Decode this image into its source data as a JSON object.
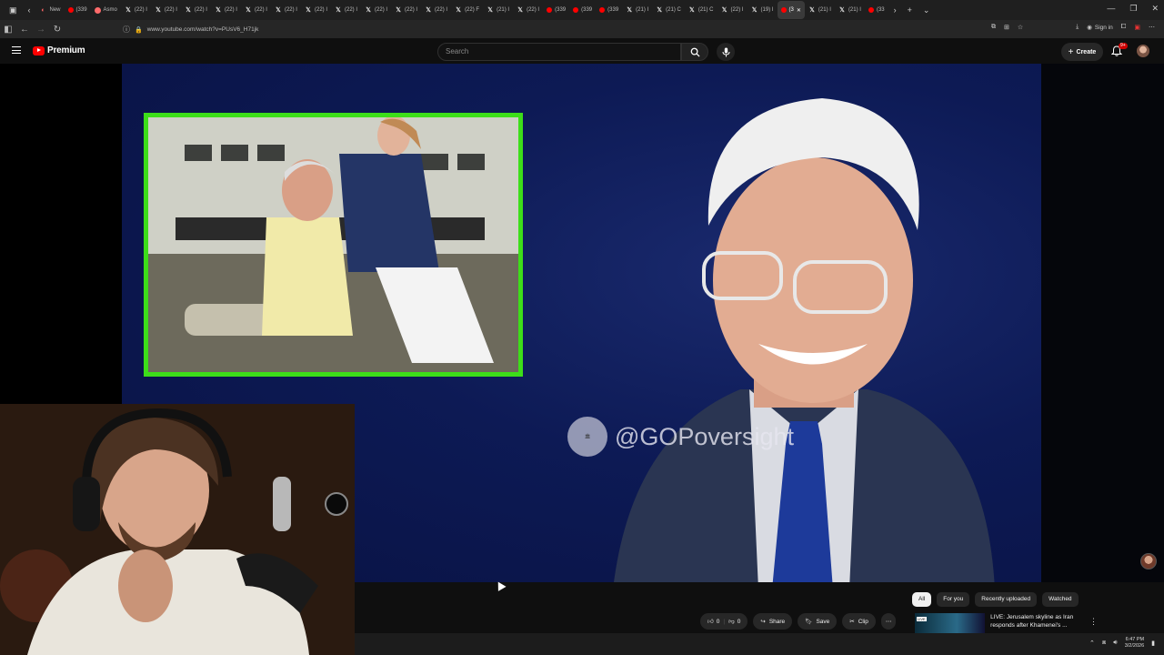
{
  "browser": {
    "tabs": [
      {
        "label": "New",
        "icon": "edge-icon"
      },
      {
        "label": "(339",
        "icon": "youtube-icon"
      },
      {
        "label": "Asmo",
        "icon": "asmongold-icon"
      },
      {
        "label": "(22) I",
        "icon": "x-icon"
      },
      {
        "label": "(22) I",
        "icon": "x-icon"
      },
      {
        "label": "(22) I",
        "icon": "x-icon"
      },
      {
        "label": "(22) I",
        "icon": "x-icon"
      },
      {
        "label": "(22) I",
        "icon": "x-icon"
      },
      {
        "label": "(22) I",
        "icon": "x-icon"
      },
      {
        "label": "(22) I",
        "icon": "x-icon"
      },
      {
        "label": "(22) I",
        "icon": "x-icon"
      },
      {
        "label": "(22) I",
        "icon": "x-icon"
      },
      {
        "label": "(22) I",
        "icon": "x-icon"
      },
      {
        "label": "(22) I",
        "icon": "x-icon"
      },
      {
        "label": "(22) F",
        "icon": "x-icon"
      },
      {
        "label": "(21) I",
        "icon": "x-icon"
      },
      {
        "label": "(22) I",
        "icon": "x-icon"
      },
      {
        "label": "(339",
        "icon": "youtube-icon"
      },
      {
        "label": "(339",
        "icon": "youtube-icon"
      },
      {
        "label": "(339",
        "icon": "youtube-icon"
      },
      {
        "label": "(21) I",
        "icon": "x-icon"
      },
      {
        "label": "(21) C",
        "icon": "x-icon"
      },
      {
        "label": "(21) C",
        "icon": "x-icon"
      },
      {
        "label": "(22) I",
        "icon": "x-icon"
      },
      {
        "label": "(19) I",
        "icon": "x-icon"
      },
      {
        "label": "(3",
        "icon": "youtube-icon",
        "active": true
      },
      {
        "label": "(21) I",
        "icon": "x-icon"
      },
      {
        "label": "(21) I",
        "icon": "x-icon"
      },
      {
        "label": "(33",
        "icon": "youtube-icon"
      }
    ],
    "url": "www.youtube.com/watch?v=PUsV6_H71jk",
    "sign_in": "Sign in"
  },
  "youtube": {
    "logo_text": "Premium",
    "search_placeholder": "Search",
    "create_label": "Create",
    "notification_count": "9+",
    "video": {
      "watermark": "@GOPoversight"
    },
    "chips": [
      {
        "label": "All",
        "selected": true
      },
      {
        "label": "For you",
        "selected": false
      },
      {
        "label": "Recently uploaded",
        "selected": false
      },
      {
        "label": "Watched",
        "selected": false
      }
    ],
    "actions": {
      "like_count": "0",
      "dislike_count": "0",
      "share": "Share",
      "save": "Save",
      "clip": "Clip"
    },
    "recommended": {
      "badge": "LIVE",
      "title": "LIVE: Jerusalem skyline as Iran responds after Khamenei's ..."
    }
  },
  "taskbar": {
    "time": "6:47 PM",
    "date": "3/2/2026"
  },
  "colors": {
    "inset_border": "#3dde19",
    "youtube_red": "#ff0000",
    "video_bg": "#0d1a55"
  }
}
